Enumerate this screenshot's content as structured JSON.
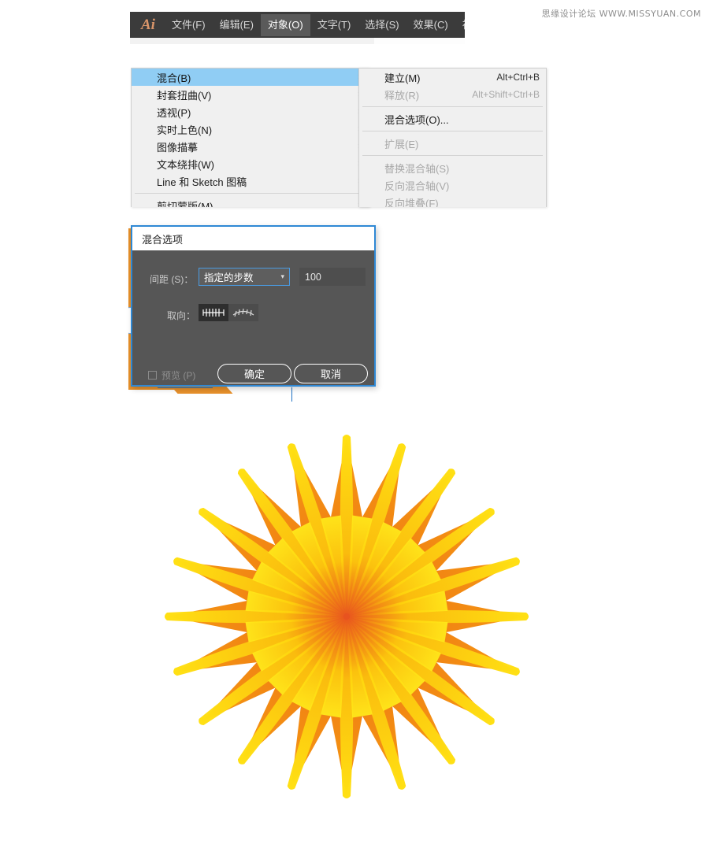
{
  "watermark": "思缘设计论坛  WWW.MISSYUAN.COM",
  "menubar": {
    "logo": "Ai",
    "items": [
      {
        "label": "文件(F)",
        "active": false
      },
      {
        "label": "编辑(E)",
        "active": false
      },
      {
        "label": "对象(O)",
        "active": true
      },
      {
        "label": "文字(T)",
        "active": false
      },
      {
        "label": "选择(S)",
        "active": false
      },
      {
        "label": "效果(C)",
        "active": false
      },
      {
        "label": "视图(V",
        "active": false
      }
    ]
  },
  "menu_left": {
    "items": [
      {
        "label": "混合(B)",
        "selected": true,
        "disabled": false,
        "arrow": "›",
        "sep_after": false
      },
      {
        "label": "封套扭曲(V)",
        "selected": false,
        "disabled": false,
        "arrow": "›",
        "sep_after": false
      },
      {
        "label": "透视(P)",
        "selected": false,
        "disabled": false,
        "arrow": "›",
        "sep_after": false
      },
      {
        "label": "实时上色(N)",
        "selected": false,
        "disabled": false,
        "arrow": "›",
        "sep_after": false
      },
      {
        "label": "图像描摹",
        "selected": false,
        "disabled": false,
        "arrow": "›",
        "sep_after": false
      },
      {
        "label": "文本绕排(W)",
        "selected": false,
        "disabled": false,
        "arrow": "›",
        "sep_after": false
      },
      {
        "label": "Line 和 Sketch 图稿",
        "selected": false,
        "disabled": false,
        "arrow": "›",
        "sep_after": true
      },
      {
        "label": "剪切蒙版(M)",
        "selected": false,
        "disabled": false,
        "arrow": "›",
        "sep_after": false
      }
    ]
  },
  "menu_right": {
    "items": [
      {
        "label": "建立(M)",
        "shortcut": "Alt+Ctrl+B",
        "disabled": false,
        "sep_after": false
      },
      {
        "label": "释放(R)",
        "shortcut": "Alt+Shift+Ctrl+B",
        "disabled": true,
        "sep_after": true
      },
      {
        "label": "混合选项(O)...",
        "shortcut": "",
        "disabled": false,
        "sep_after": true
      },
      {
        "label": "扩展(E)",
        "shortcut": "",
        "disabled": true,
        "sep_after": true
      },
      {
        "label": "替换混合轴(S)",
        "shortcut": "",
        "disabled": true,
        "sep_after": false
      },
      {
        "label": "反向混合轴(V)",
        "shortcut": "",
        "disabled": true,
        "sep_after": false
      },
      {
        "label": "反向堆叠(F)",
        "shortcut": "",
        "disabled": true,
        "sep_after": false
      }
    ]
  },
  "dialog": {
    "title": "混合选项",
    "spacing_label": "间距 (S)：",
    "spacing_value": "指定的步数",
    "spacing_caret": "chevron-down-icon",
    "steps_value": "100",
    "orientation_label": "取向：",
    "orientation_options": [
      "align-to-page-icon",
      "align-to-path-icon"
    ],
    "orientation_selected": 0,
    "preview_label": "预览 (P)",
    "preview_checked": false,
    "ok_label": "确定",
    "cancel_label": "取消"
  },
  "artwork": {
    "name": "blended-starburst",
    "points": 20,
    "center_color": "#e8531f",
    "spike_color": "#ffe013",
    "body_color": "#f59a12"
  }
}
